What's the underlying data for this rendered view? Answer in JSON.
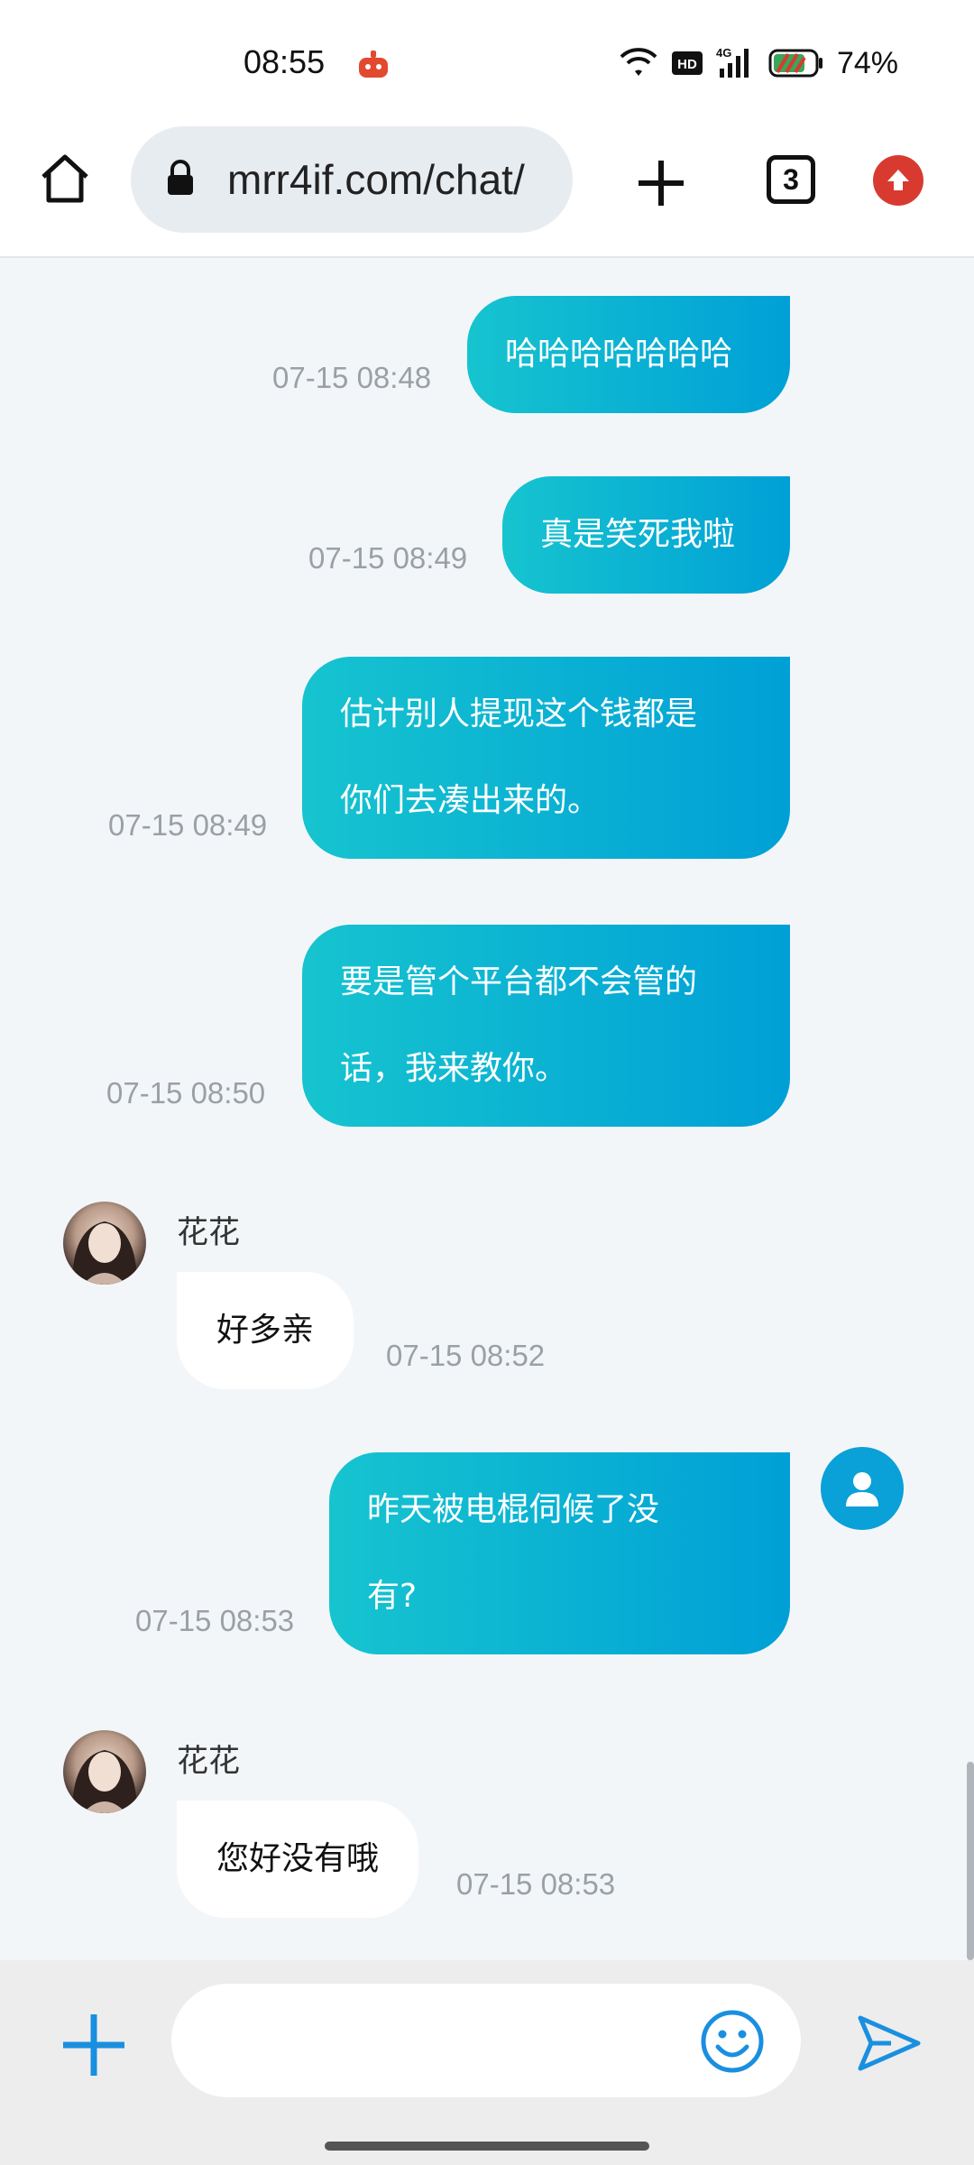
{
  "status_bar": {
    "time": "08:55",
    "battery_percent": "74%",
    "icons": [
      "app-notification-icon",
      "wifi-icon",
      "hd-icon",
      "4g-signal-icon",
      "battery-icon"
    ]
  },
  "browser": {
    "url": "mrr4if.com/chat/",
    "tab_count": "3",
    "icons": [
      "home-icon",
      "lock-icon",
      "plus-icon",
      "tabs-icon",
      "update-arrow-icon"
    ]
  },
  "chat": {
    "messages": [
      {
        "direction": "out",
        "text": "哈哈哈哈哈哈哈",
        "time": "07-15 08:48"
      },
      {
        "direction": "out",
        "text": "真是笑死我啦",
        "time": "07-15 08:49"
      },
      {
        "direction": "out",
        "text": "估计别人提现这个钱都是\n你们去凑出来的。",
        "time": "07-15 08:49"
      },
      {
        "direction": "out",
        "text": "要是管个平台都不会管的\n话，我来教你。",
        "time": "07-15 08:50"
      },
      {
        "direction": "in",
        "sender": "花花",
        "text": "好多亲",
        "time": "07-15 08:52"
      },
      {
        "direction": "out",
        "text": "昨天被电棍伺候了没\n有?",
        "time": "07-15 08:53"
      },
      {
        "direction": "in",
        "sender": "花花",
        "text": "您好没有哦",
        "time": "07-15 08:53"
      }
    ]
  },
  "input": {
    "placeholder": "",
    "icons": [
      "plus-icon",
      "emoji-icon",
      "send-icon"
    ]
  },
  "colors": {
    "bubble_gradient_start": "#16c4cf",
    "bubble_gradient_end": "#00a0d6",
    "accent": "#1a8fe0",
    "update_red": "#d93a2f"
  }
}
